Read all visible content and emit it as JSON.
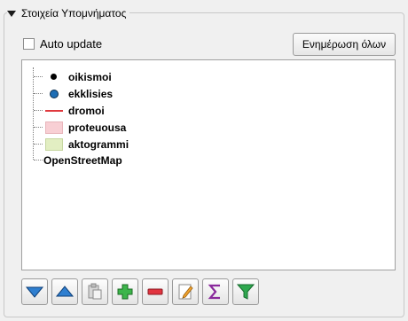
{
  "panel": {
    "title": "Στοιχεία Υπομνήματος",
    "auto_update_label": "Auto update",
    "auto_update_checked": false,
    "refresh_button_label": "Ενημέρωση όλων"
  },
  "legend_tree": {
    "group_name": "OpenStreetMap",
    "layers": [
      {
        "name": "oikismoi",
        "symbol": "black-point",
        "color": "#000000"
      },
      {
        "name": "ekklisies",
        "symbol": "blue-point",
        "color": "#1e6eb5"
      },
      {
        "name": "dromoi",
        "symbol": "red-line",
        "color": "#e0393e"
      },
      {
        "name": "proteuousa",
        "symbol": "pink-fill",
        "color": "#f8cfd4"
      },
      {
        "name": "aktogrammi",
        "symbol": "green-fill",
        "color": "#e2eec2"
      }
    ]
  },
  "toolbar": {
    "buttons": [
      {
        "icon": "move-down-icon"
      },
      {
        "icon": "move-up-icon"
      },
      {
        "icon": "paste-icon"
      },
      {
        "icon": "add-icon"
      },
      {
        "icon": "remove-icon"
      },
      {
        "icon": "edit-icon"
      },
      {
        "icon": "sigma-icon"
      },
      {
        "icon": "filter-icon"
      }
    ]
  }
}
